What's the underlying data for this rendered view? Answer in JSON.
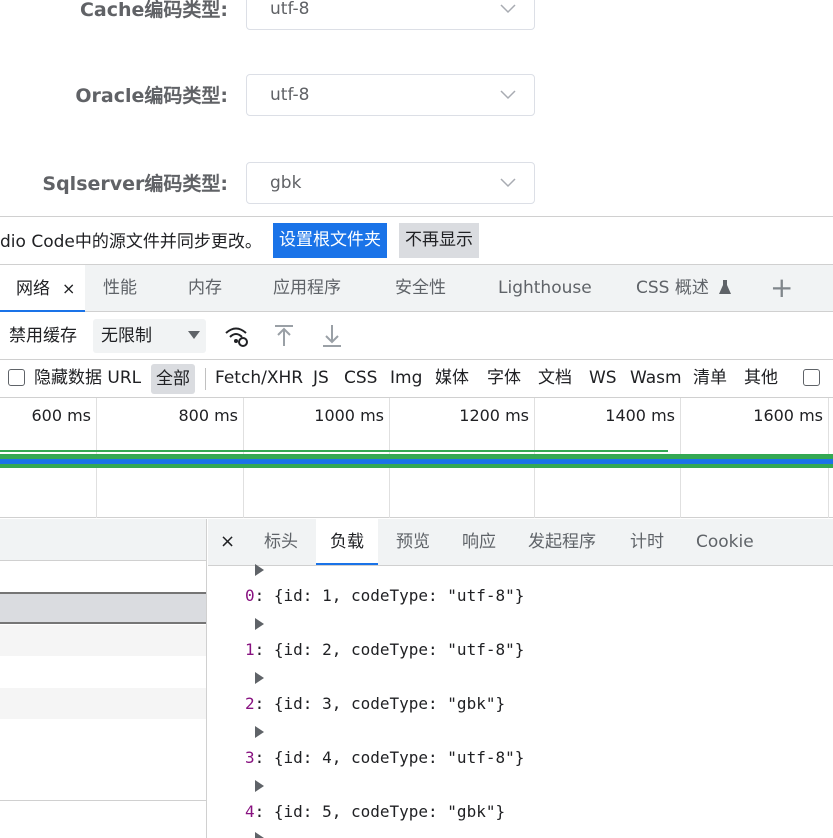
{
  "form": {
    "rows": [
      {
        "label": "Cache编码类型:",
        "value": "utf-8"
      },
      {
        "label": "Oracle编码类型:",
        "value": "utf-8"
      },
      {
        "label": "Sqlserver编码类型:",
        "value": "gbk"
      }
    ]
  },
  "infobar": {
    "text": "dio Code中的源文件并同步更改。",
    "primary_button": "设置根文件夹",
    "secondary_button": "不再显示"
  },
  "tabs": {
    "active": "网络",
    "close": "×",
    "items": [
      "性能",
      "内存",
      "应用程序",
      "安全性",
      "Lighthouse",
      "CSS 概述"
    ],
    "css_overview_icon": "flask-icon",
    "plus": "+"
  },
  "toolbar": {
    "disable_cache": "禁用缓存",
    "throttle": "无限制"
  },
  "filter": {
    "hide_data_url": "隐藏数据 URL",
    "all": "全部",
    "types": [
      "Fetch/XHR",
      "JS",
      "CSS",
      "Img",
      "媒体",
      "字体",
      "文档",
      "WS",
      "Wasm",
      "清单",
      "其他"
    ]
  },
  "timeline": {
    "ticks": [
      "600 ms",
      "800 ms",
      "1000 ms",
      "1200 ms",
      "1400 ms",
      "1600 ms"
    ]
  },
  "detail_tabs": {
    "close": "×",
    "items": [
      "标头",
      "负载",
      "预览",
      "响应",
      "发起程序",
      "计时",
      "Cookie"
    ],
    "active": "负载"
  },
  "payload": {
    "entries": [
      {
        "index": "0",
        "text": ": {id: 1, codeType: \"utf-8\"}"
      },
      {
        "index": "1",
        "text": ": {id: 2, codeType: \"utf-8\"}"
      },
      {
        "index": "2",
        "text": ": {id: 3, codeType: \"gbk\"}"
      },
      {
        "index": "3",
        "text": ": {id: 4, codeType: \"utf-8\"}"
      },
      {
        "index": "4",
        "text": ": {id: 5, codeType: \"gbk\"}"
      }
    ]
  },
  "colors": {
    "accent": "#1a73e8",
    "waterfall_green": "#34a853",
    "index_purple": "#881280"
  }
}
